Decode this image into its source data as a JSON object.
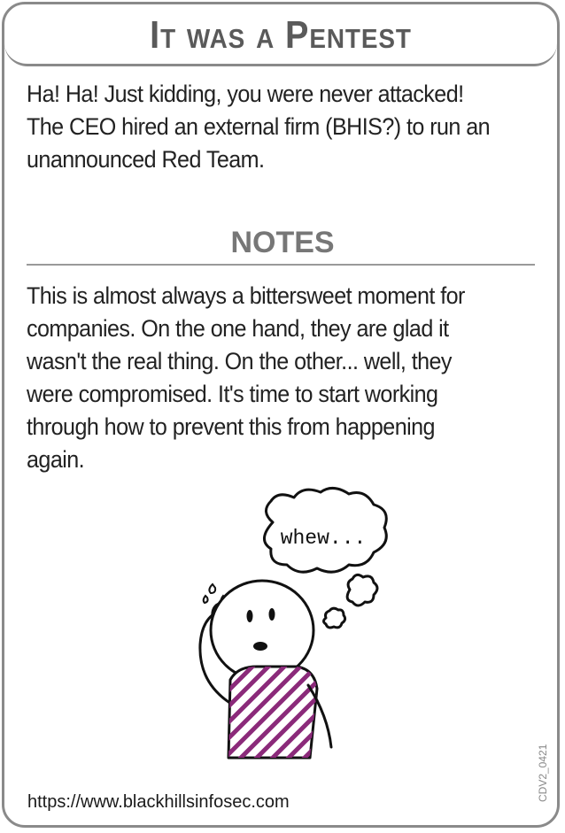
{
  "card": {
    "title": "It was a Pentest",
    "intro": "Ha! Ha! Just kidding, you were never attacked! The CEO hired an external firm (BHIS?) to run an unannounced Red Team.",
    "notes_heading": "NOTES",
    "notes_body": "This is almost always a bittersweet moment for companies. On the one hand, they are glad it wasn't the real thing. On the other... well, they were compromised. It's time to start working through how to prevent this from happening again.",
    "illustration_text": "whew...",
    "footer_url": "https://www.blackhillsinfosec.com",
    "card_code": "CDV2_0421"
  },
  "colors": {
    "border": "#8a8a8a",
    "title": "#5a5a5a",
    "shirt": "#8b2a7a"
  }
}
